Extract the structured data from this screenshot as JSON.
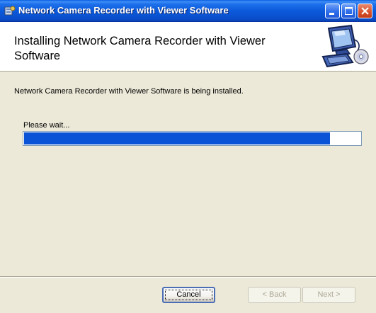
{
  "window": {
    "title": "Network Camera Recorder with Viewer Software"
  },
  "header": {
    "title": "Installing Network Camera Recorder with Viewer Software"
  },
  "body": {
    "status_text": "Network Camera Recorder with Viewer Software is being installed.",
    "wait_text": "Please wait...",
    "progress_fraction": 0.91
  },
  "buttons": {
    "cancel": "Cancel",
    "back": "< Back",
    "next": "Next >"
  },
  "colors": {
    "titlebar_blue": "#0B58DA",
    "progress_blue": "#0A52D6",
    "dialog_bg": "#ECE9D8"
  }
}
